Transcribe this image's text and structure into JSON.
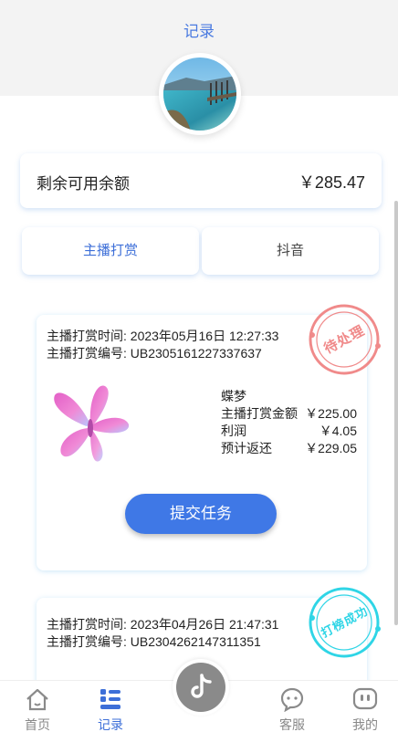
{
  "header": {
    "title": "记录"
  },
  "balance": {
    "label": "剩余可用余额",
    "value": "￥285.47"
  },
  "tabs": [
    {
      "label": "主播打赏",
      "active": true
    },
    {
      "label": "抖音",
      "active": false
    }
  ],
  "orders": [
    {
      "time_label": "主播打赏时间:",
      "time": "2023年05月16日 12:27:33",
      "no_label": "主播打赏编号:",
      "no": "UB2305161227337637",
      "stamp": "待处理",
      "stamp_color": "#f08a8a",
      "name": "蝶梦",
      "amount_label": "主播打赏金额",
      "amount": "￥225.00",
      "profit_label": "利润",
      "profit": "￥4.05",
      "return_label": "预计返还",
      "return": "￥229.05",
      "button": "提交任务"
    },
    {
      "time_label": "主播打赏时间:",
      "time": "2023年04月26日 21:47:31",
      "no_label": "主播打赏编号:",
      "no": "UB2304262147311351",
      "stamp": "打榜成功",
      "stamp_color": "#2fd5e6"
    }
  ],
  "tabbar": {
    "items": [
      {
        "label": "首页",
        "icon": "home-icon"
      },
      {
        "label": "记录",
        "icon": "list-icon",
        "active": true
      },
      {
        "label": "",
        "icon": "tiktok-icon"
      },
      {
        "label": "客服",
        "icon": "chat-bubble-icon"
      },
      {
        "label": "我的",
        "icon": "profile-icon"
      }
    ]
  },
  "colors": {
    "accent": "#3f78e6",
    "active": "#3d6fd8"
  }
}
